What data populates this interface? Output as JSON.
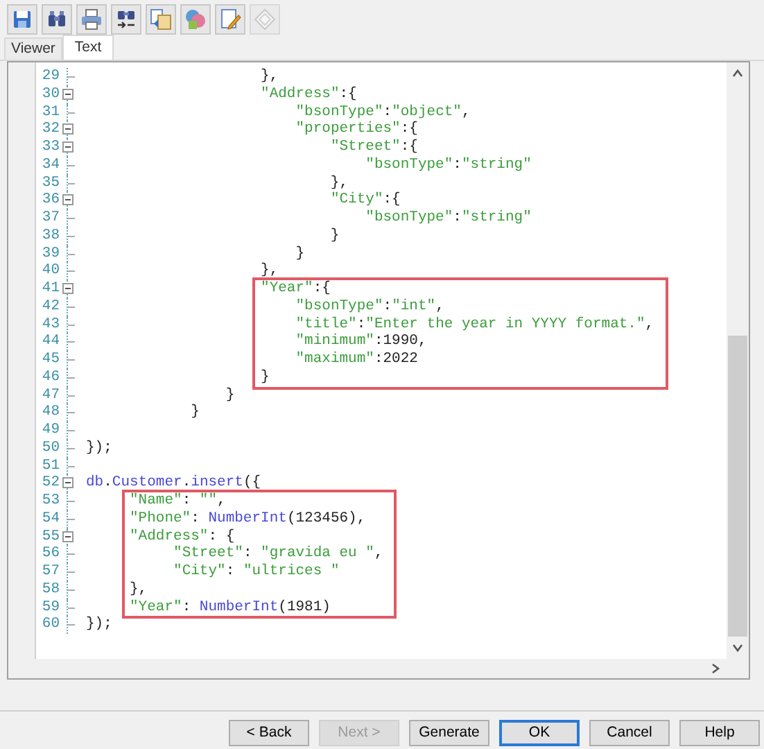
{
  "toolbar": [
    {
      "kind": "save",
      "disabled": false
    },
    {
      "kind": "find",
      "disabled": false
    },
    {
      "kind": "print",
      "disabled": false
    },
    {
      "kind": "replace",
      "disabled": false
    },
    {
      "kind": "copy",
      "disabled": false
    },
    {
      "kind": "palette",
      "disabled": false
    },
    {
      "kind": "edit",
      "disabled": false
    },
    {
      "kind": "diamond",
      "disabled": true
    }
  ],
  "tabs": [
    {
      "label": "Viewer",
      "selected": false
    },
    {
      "label": "Text",
      "selected": true
    }
  ],
  "editor": {
    "blocks": [
      {
        "boxed": false,
        "lines": [
          {
            "number": "29",
            "text": "                    },",
            "foldable": false
          },
          {
            "number": "30",
            "text": "                    \"Address\":{",
            "foldable": true
          },
          {
            "number": "31",
            "text": "                        \"bsonType\":\"object\",",
            "foldable": false
          },
          {
            "number": "32",
            "text": "                        \"properties\":{",
            "foldable": true
          },
          {
            "number": "33",
            "text": "                            \"Street\":{",
            "foldable": true
          },
          {
            "number": "34",
            "text": "                                \"bsonType\":\"string\"",
            "foldable": false
          },
          {
            "number": "35",
            "text": "                            },",
            "foldable": false
          },
          {
            "number": "36",
            "text": "                            \"City\":{",
            "foldable": true
          },
          {
            "number": "37",
            "text": "                                \"bsonType\":\"string\"",
            "foldable": false
          },
          {
            "number": "38",
            "text": "                            }",
            "foldable": false
          },
          {
            "number": "39",
            "text": "                        }",
            "foldable": false
          },
          {
            "number": "40",
            "text": "                    },",
            "foldable": false
          }
        ]
      },
      {
        "boxed": true,
        "lines": [
          {
            "number": "41",
            "text": "                    \"Year\":{",
            "foldable": true
          },
          {
            "number": "42",
            "text": "                        \"bsonType\":\"int\",",
            "foldable": false
          },
          {
            "number": "43",
            "text": "                        \"title\":\"Enter the year in YYYY format.\",",
            "foldable": false
          },
          {
            "number": "44",
            "text": "                        \"minimum\":1990,",
            "foldable": false
          },
          {
            "number": "45",
            "text": "                        \"maximum\":2022",
            "foldable": false
          },
          {
            "number": "46",
            "text": "                    }",
            "foldable": false
          }
        ]
      },
      {
        "boxed": false,
        "lines": [
          {
            "number": "47",
            "text": "                }",
            "foldable": false
          },
          {
            "number": "48",
            "text": "            }",
            "foldable": false
          },
          {
            "number": "49",
            "foldable": false
          },
          {
            "number": "50",
            "text": "});",
            "foldable": false
          },
          {
            "number": "51",
            "foldable": false
          },
          {
            "number": "52",
            "text": "db.Customer.insert({",
            "foldable": true
          }
        ]
      },
      {
        "boxed": true,
        "lines": [
          {
            "number": "53",
            "text": "     \"Name\": \"\",",
            "foldable": false
          },
          {
            "number": "54",
            "text": "     \"Phone\": NumberInt(123456),",
            "foldable": false
          },
          {
            "number": "55",
            "text": "     \"Address\": {",
            "foldable": true
          },
          {
            "number": "56",
            "text": "          \"Street\": \"gravida eu \",",
            "foldable": false
          },
          {
            "number": "57",
            "text": "          \"City\": \"ultrices \"",
            "foldable": false
          },
          {
            "number": "58",
            "text": "     },",
            "foldable": false
          },
          {
            "number": "59",
            "text": "     \"Year\": NumberInt(1981)",
            "foldable": false
          }
        ]
      },
      {
        "boxed": false,
        "lines": [
          {
            "number": "60",
            "text": "});",
            "foldable": false
          }
        ]
      }
    ]
  },
  "buttons": [
    {
      "label": "< Back",
      "disabled": false,
      "default": false
    },
    {
      "label": "Next >",
      "disabled": true,
      "default": false
    },
    {
      "label": "Generate",
      "disabled": false,
      "default": false
    },
    {
      "label": "OK",
      "disabled": false,
      "default": true
    },
    {
      "label": "Cancel",
      "disabled": false,
      "default": false
    },
    {
      "label": "Help",
      "disabled": false,
      "default": false
    }
  ]
}
